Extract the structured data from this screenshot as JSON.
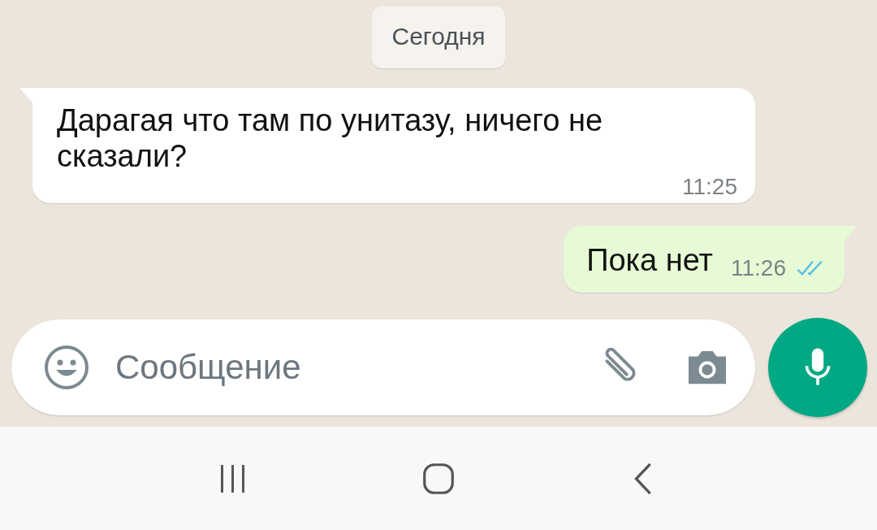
{
  "date_chip": "Сегодня",
  "messages": [
    {
      "kind": "incoming",
      "text": "Дарагая что там по унитазу, ничего не сказали?",
      "time": "11:25"
    },
    {
      "kind": "outgoing",
      "text": "Пока нет",
      "time": "11:26",
      "read": true
    }
  ],
  "composer": {
    "placeholder": "Сообщение"
  }
}
